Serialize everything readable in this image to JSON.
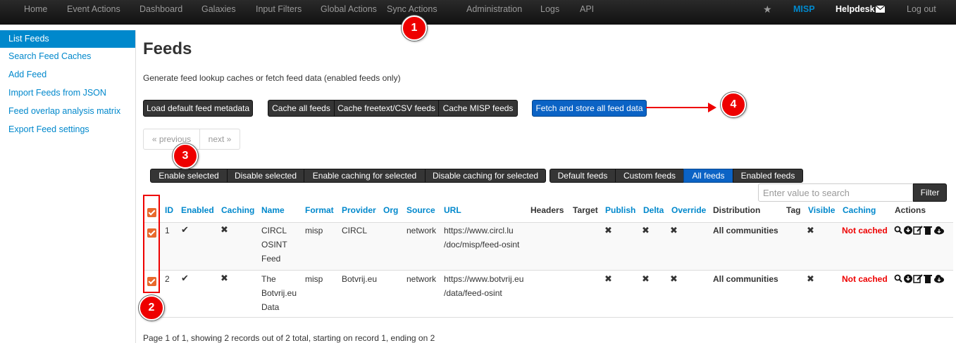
{
  "navbar": {
    "items": [
      "Home",
      "Event Actions",
      "Dashboard",
      "Galaxies",
      "Input Filters",
      "Global Actions",
      "Sync Actions",
      "Administration",
      "Logs",
      "API"
    ],
    "brand": "MISP",
    "helpdesk": "Helpdesk",
    "logout": "Log out"
  },
  "sidebar": {
    "items": [
      "List Feeds",
      "Search Feed Caches",
      "Add Feed",
      "Import Feeds from JSON",
      "Feed overlap analysis matrix",
      "Export Feed settings"
    ]
  },
  "main": {
    "title": "Feeds",
    "description": "Generate feed lookup caches or fetch feed data (enabled feeds only)",
    "buttons": {
      "load_default": "Load default feed metadata",
      "cache_all": "Cache all feeds",
      "cache_freetext": "Cache freetext/CSV feeds",
      "cache_misp": "Cache MISP feeds",
      "fetch_store": "Fetch and store all feed data"
    },
    "pagination": {
      "previous": "« previous",
      "next": "next »"
    },
    "selection_actions": [
      "Enable selected",
      "Disable selected",
      "Enable caching for selected",
      "Disable caching for selected"
    ],
    "filters": [
      "Default feeds",
      "Custom feeds",
      "All feeds",
      "Enabled feeds"
    ],
    "search": {
      "placeholder": "Enter value to search",
      "button": "Filter"
    },
    "footer": "Page 1 of 1, showing 2 records out of 2 total, starting on record 1, ending on 2"
  },
  "table": {
    "headers": [
      "ID",
      "Enabled",
      "Caching",
      "Name",
      "Format",
      "Provider",
      "Org",
      "Source",
      "URL",
      "Headers",
      "Target",
      "Publish",
      "Delta",
      "Override",
      "Distribution",
      "Tag",
      "Visible",
      "Caching",
      "Actions"
    ],
    "rows": [
      {
        "id": "1",
        "name": [
          "CIRCL",
          "OSINT",
          "Feed"
        ],
        "format": "misp",
        "provider": "CIRCL",
        "source": "network",
        "url": [
          "https://www.circl.lu",
          "/doc/misp/feed-osint"
        ],
        "distribution": "All communities",
        "caching_status": "Not cached"
      },
      {
        "id": "2",
        "name": [
          "The",
          "Botvrij.eu",
          "Data"
        ],
        "format": "misp",
        "provider": "Botvrij.eu",
        "source": "network",
        "url": [
          "https://www.botvrij.eu",
          "/data/feed-osint"
        ],
        "distribution": "All communities",
        "caching_status": "Not cached"
      }
    ]
  },
  "annotations": [
    "1",
    "2",
    "3",
    "4"
  ],
  "colors": {
    "accent": "#0088cc",
    "navbar": "#1c1c1c",
    "primary_button": "#0b63c5",
    "checkbox": "#e8682c",
    "annotation": "#e00000",
    "not_cached": "#e00000"
  },
  "icons": {
    "star": "star-icon",
    "envelope": "envelope-icon",
    "check": "check-icon",
    "cross": "cross-icon",
    "actions": [
      "search-icon",
      "download-icon",
      "edit-icon",
      "trash-icon",
      "cloud-download-icon"
    ]
  }
}
